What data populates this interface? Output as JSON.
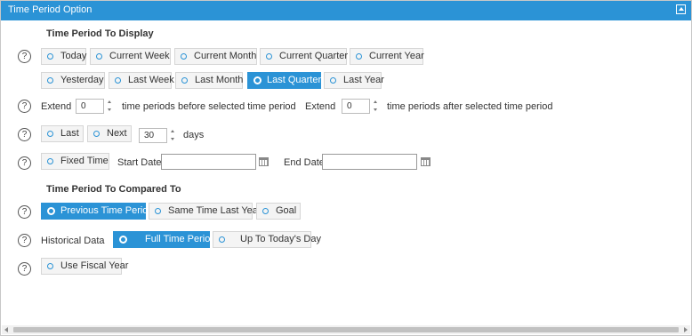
{
  "panel": {
    "title": "Time Period Option"
  },
  "display": {
    "heading": "Time Period To Display",
    "row1": [
      "Today",
      "Current Week",
      "Current Month",
      "Current Quarter",
      "Current Year"
    ],
    "row2": [
      "Yesterday",
      "Last Week",
      "Last Month",
      "Last Quarter",
      "Last Year"
    ],
    "selected": "Last Quarter",
    "extend": {
      "label": "Extend",
      "before_value": "0",
      "before_text": "time periods before selected time period",
      "label2": "Extend",
      "after_value": "0",
      "after_text": "time periods after selected time period"
    },
    "lastnext": {
      "last": "Last",
      "next": "Next",
      "value": "30",
      "unit": "days"
    },
    "fixed": {
      "label": "Fixed Time",
      "start_label": "Start Date:",
      "start_value": "",
      "end_label": "End Date:",
      "end_value": ""
    }
  },
  "compare": {
    "heading": "Time Period To Compared To",
    "options": [
      "Previous Time Period",
      "Same Time Last Year",
      "Goal"
    ],
    "selected": "Previous Time Period",
    "historical": {
      "label": "Historical Data",
      "options": [
        "Full Time Period",
        "Up To Today's Day"
      ],
      "selected": "Full Time Period"
    },
    "fiscal": "Use Fiscal Year"
  },
  "help_glyph": "?",
  "colors": {
    "accent": "#2b93d6",
    "option_bg": "#f4f4f4",
    "border": "#c8c8c8"
  }
}
